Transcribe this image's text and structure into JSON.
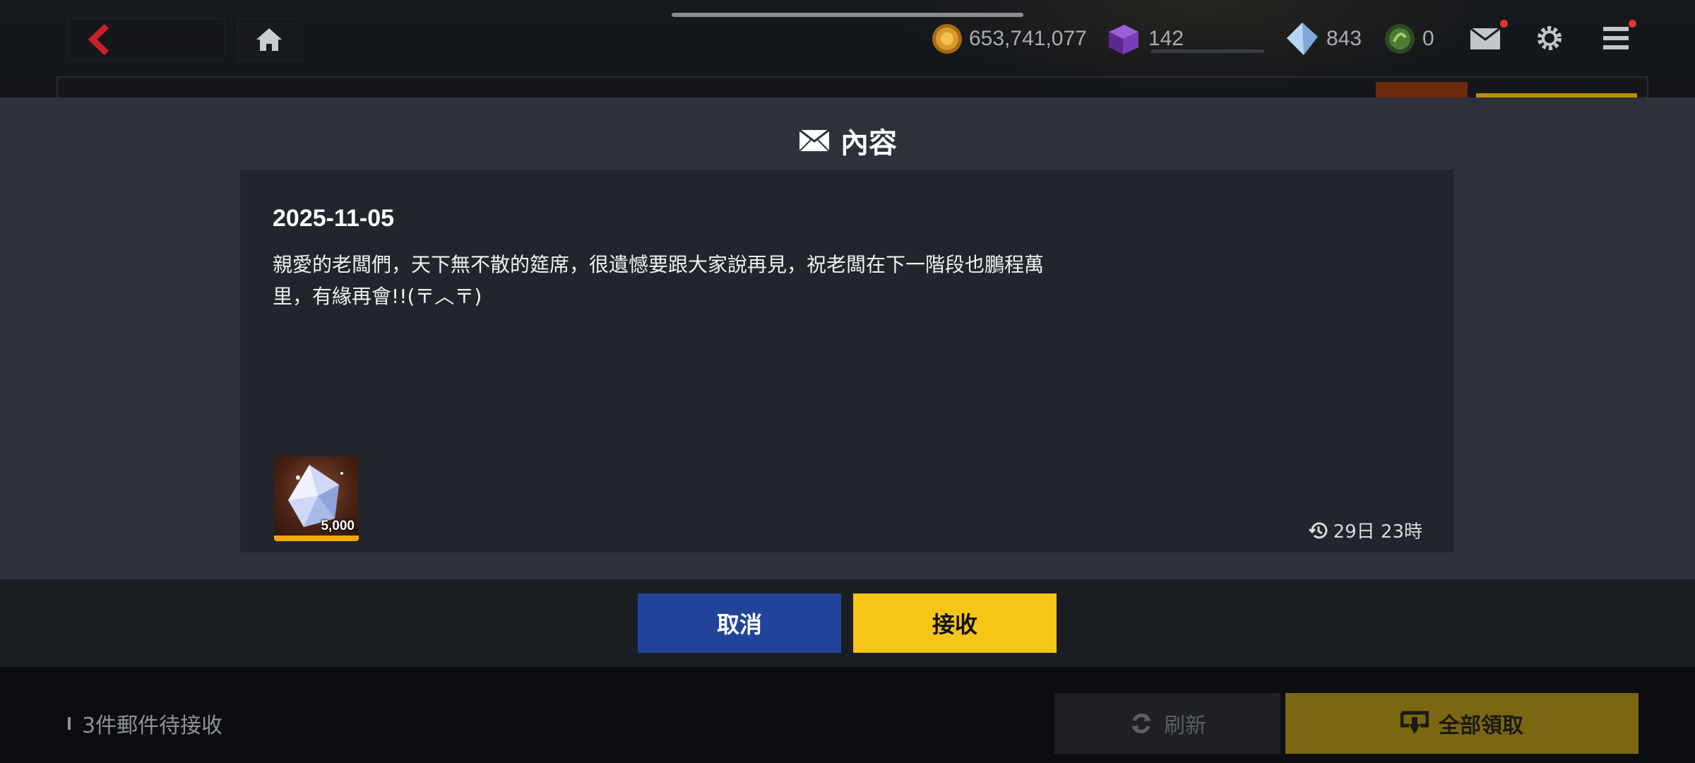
{
  "topbar": {
    "gold": "653,741,077",
    "tickets": "142",
    "crystals": "843",
    "tokens": "0"
  },
  "modal": {
    "title": "內容",
    "date": "2025-11-05",
    "body": "親愛的老闆們，天下無不散的筵席，很遺憾要跟大家說再見，祝老闆在下一階段也鵬程萬里，有緣再會!!(〒︿〒)",
    "reward_quantity": "5,000",
    "expiry": "29日 23時",
    "cancel_label": "取消",
    "accept_label": "接收"
  },
  "footer": {
    "pending_text": "3件郵件待接收",
    "refresh_label": "刷新",
    "claim_all_label": "全部領取"
  }
}
